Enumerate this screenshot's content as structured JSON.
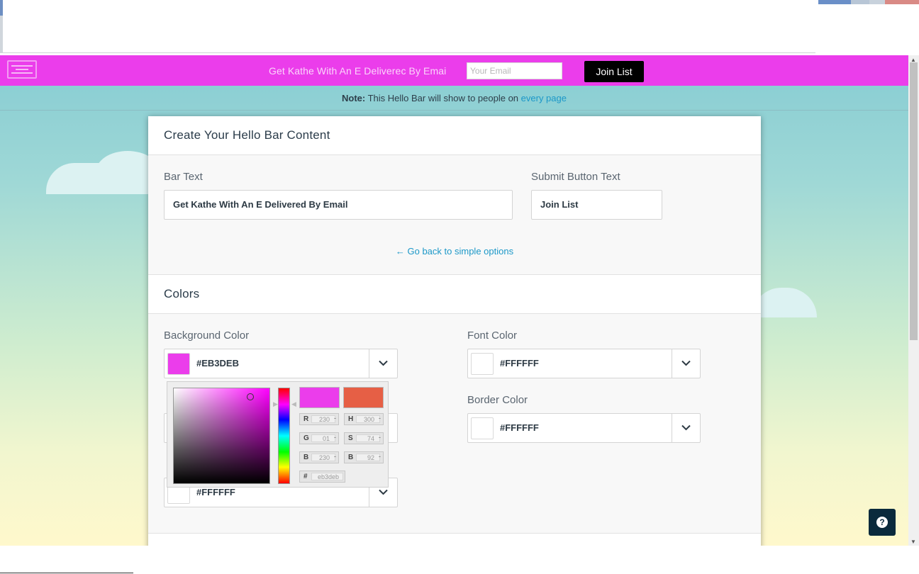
{
  "colors": {
    "hellobar_bg": "#eb3deb",
    "join_button_bg": "#000000",
    "link": "#1c98c8",
    "help_button_bg": "#0a2a3c",
    "picker_previous": "#e65f45"
  },
  "hellobar": {
    "text": "Get Kathe With An E Deliverec By Emai",
    "email_placeholder": "Your Email",
    "button_label": "Join List"
  },
  "note": {
    "prefix": "Note:",
    "text": " This Hello Bar will show to people on ",
    "link": "every page"
  },
  "content_section": {
    "title": "Create Your Hello Bar Content",
    "bar_text_label": "Bar Text",
    "bar_text_value": "Get Kathe With An E Delivered By Email",
    "button_text_label": "Submit Button Text",
    "button_text_value": "Join List",
    "back_link": "← Go back to simple options"
  },
  "colors_section": {
    "title": "Colors",
    "background": {
      "label": "Background Color",
      "hex": "#EB3DEB",
      "swatch": "#eb3deb"
    },
    "font": {
      "label": "Font Color",
      "hex": "#FFFFFF",
      "swatch": "#ffffff"
    },
    "border": {
      "label": "Border Color",
      "hex": "#FFFFFF",
      "swatch": "#ffffff"
    },
    "obscured": {
      "hex": "#FFFFFF",
      "swatch": "#ffffff"
    }
  },
  "picker": {
    "fields": [
      {
        "key": "R",
        "value": "230"
      },
      {
        "key": "G",
        "value": "01"
      },
      {
        "key": "B",
        "value": "230"
      },
      {
        "key": "H",
        "value": "300"
      },
      {
        "key": "S",
        "value": "74"
      },
      {
        "key": "B",
        "value": "92"
      }
    ],
    "hex_key": "#",
    "hex_value": "eb3deb"
  },
  "icons": {
    "logo": "hellobar-logo-icon",
    "dropdown": "chevron-down-icon",
    "help": "question-icon"
  }
}
